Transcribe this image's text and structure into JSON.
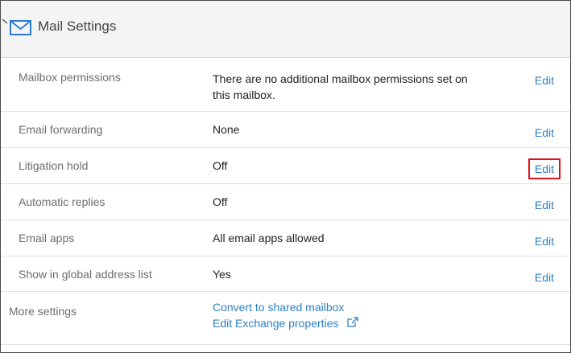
{
  "header": {
    "title": "Mail Settings",
    "icons": [
      "collapse-caret-icon",
      "envelope-icon"
    ]
  },
  "rows": [
    {
      "label": "Mailbox permissions",
      "value": "There are no additional mailbox permissions set on this mailbox.",
      "edit": "Edit"
    },
    {
      "label": "Email forwarding",
      "value": "None",
      "edit": "Edit"
    },
    {
      "label": "Litigation hold",
      "value": "Off",
      "edit": "Edit",
      "highlighted": true
    },
    {
      "label": "Automatic replies",
      "value": "Off",
      "edit": "Edit"
    },
    {
      "label": "Email apps",
      "value": "All email apps allowed",
      "edit": "Edit"
    },
    {
      "label": "Show in global address list",
      "value": "Yes",
      "edit": "Edit"
    }
  ],
  "more_settings": {
    "label": "More settings",
    "links": [
      "Convert to shared mailbox",
      "Edit Exchange properties"
    ],
    "external_icon": "external-link-icon"
  },
  "colors": {
    "link": "#2e7fc2",
    "highlight_border": "#e0121b",
    "header_bg": "#f4f4f4",
    "icon_blue": "#2b7cd3"
  }
}
